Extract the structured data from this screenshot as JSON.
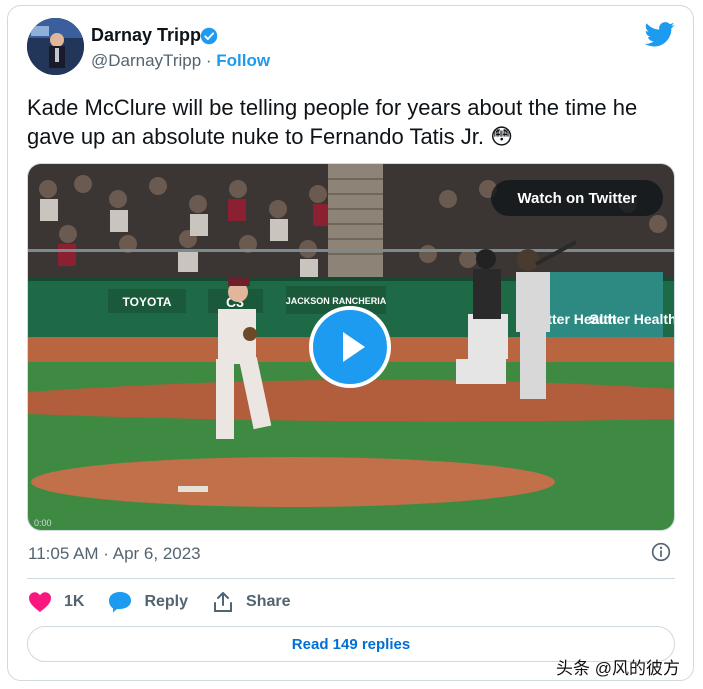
{
  "user": {
    "name": "Darnay Tripp",
    "handle": "@DarnayTripp",
    "separator": " · ",
    "follow_label": "Follow"
  },
  "tweet": {
    "text": "Kade McClure will be telling people for years about the time he gave up an absolute nuke to Fernando Tatis Jr. 😳"
  },
  "media": {
    "watch_label": "Watch on Twitter",
    "video_time": "0:00",
    "signage": [
      "TOYOTA",
      "JACKSON RANCHERIA",
      "Sutter Health",
      "Sutter Health"
    ]
  },
  "meta": {
    "timestamp": "11:05 AM · Apr 6, 2023"
  },
  "actions": {
    "likes": "1K",
    "reply_label": "Reply",
    "share_label": "Share"
  },
  "replies": {
    "label": "Read 149 replies"
  },
  "watermark": "头条 @风的彼方",
  "colors": {
    "accent": "#1d9bf0",
    "link": "#006fd6",
    "like": "#f91880",
    "muted": "#536471",
    "border": "#cfd9de"
  },
  "icons": [
    "verified-badge-icon",
    "twitter-bird-icon",
    "play-icon",
    "info-icon",
    "heart-icon",
    "reply-bubble-icon",
    "share-icon"
  ]
}
